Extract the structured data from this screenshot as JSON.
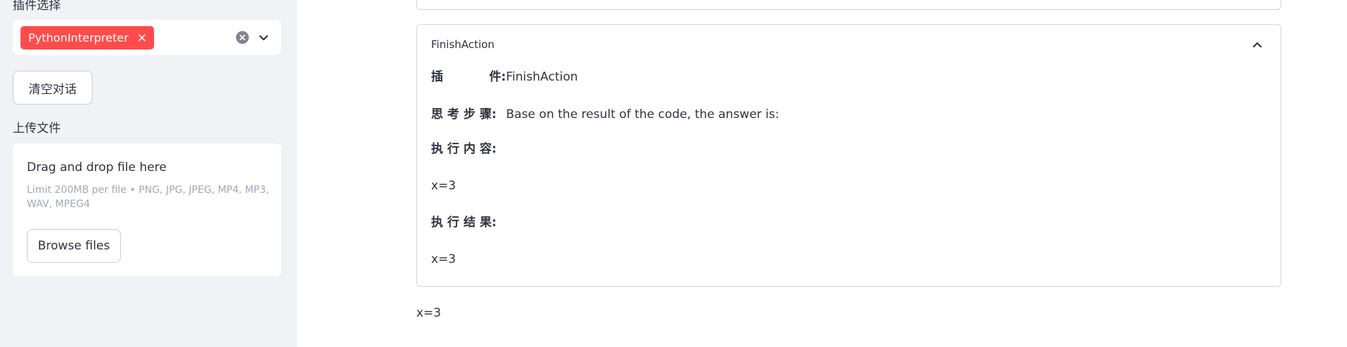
{
  "sidebar": {
    "plugin_select_label": "插件选择",
    "selected_plugin": "PythonInterpreter",
    "tag_remove_glyph": "×",
    "clear_chat_button": "清空对话",
    "upload_label": "上传文件",
    "uploader": {
      "title": "Drag and drop file here",
      "limit": "Limit 200MB per file • PNG, JPG, JPEG, MP4, MP3, WAV, MPEG4",
      "browse_button": "Browse files"
    }
  },
  "main": {
    "expander": {
      "title": "FinishAction",
      "expanded": true,
      "rows": {
        "plugin_key": [
          "插",
          "件:"
        ],
        "plugin_value": "FinishAction",
        "thought_key": "思 考 步 骤:",
        "thought_value": "Base on the result of the code, the answer is:",
        "exec_key": "执 行 内 容:",
        "exec_value": "x=3",
        "result_key": "执 行 结 果:",
        "result_value": "x=3"
      }
    },
    "final_answer": "x=3"
  },
  "colors": {
    "accent": "#ff4b4b",
    "sidebar_bg": "#f0f2f6",
    "text": "#31333f"
  },
  "icons": {
    "clear": "clear-icon",
    "dropdown": "chevron-down-icon",
    "collapse": "chevron-up-icon"
  }
}
